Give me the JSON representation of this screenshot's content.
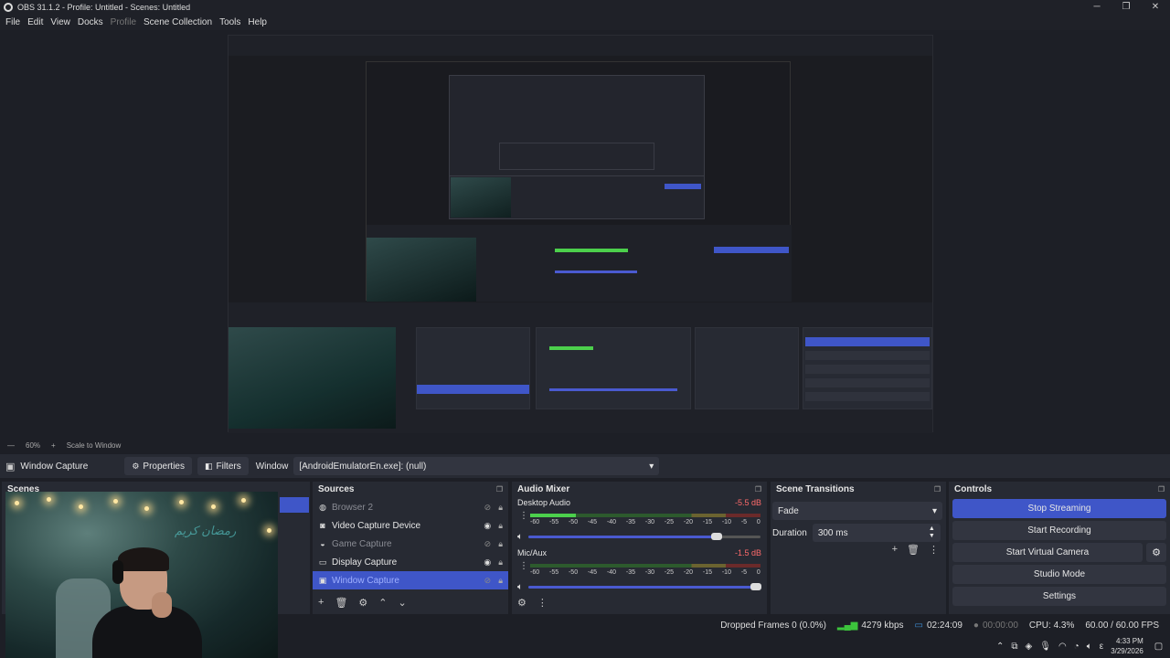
{
  "window": {
    "title": "OBS 31.1.2 - Profile: Untitled - Scenes: Untitled",
    "minimize_glyph": "─",
    "restore_glyph": "❐",
    "close_glyph": "✕"
  },
  "menu": [
    "File",
    "Edit",
    "View",
    "Docks",
    "Profile",
    "Scene Collection",
    "Tools",
    "Help"
  ],
  "zoom": {
    "minus": "—",
    "level": "60%",
    "plus": "+",
    "mode": "Scale to Window"
  },
  "source_toolbar": {
    "source_name": "Window Capture",
    "properties": "Properties",
    "filters": "Filters",
    "window_label": "Window",
    "window_value": "[AndroidEmulatorEn.exe]: (null)"
  },
  "scenes": {
    "title": "Scenes"
  },
  "sources": {
    "title": "Sources",
    "items": [
      {
        "name": "Browser 2",
        "icon": "browser-icon",
        "glyph": "◍",
        "visible": false
      },
      {
        "name": "Video Capture Device",
        "icon": "camera-icon",
        "glyph": "◙",
        "visible": true
      },
      {
        "name": "Game Capture",
        "icon": "gamepad-icon",
        "glyph": "◒",
        "visible": false
      },
      {
        "name": "Display Capture",
        "icon": "monitor-icon",
        "glyph": "▭",
        "visible": true
      },
      {
        "name": "Window Capture",
        "icon": "window-icon",
        "glyph": "▣",
        "visible": false
      }
    ]
  },
  "mixer": {
    "title": "Audio Mixer",
    "scale": [
      "-60",
      "-55",
      "-50",
      "-45",
      "-40",
      "-35",
      "-30",
      "-25",
      "-20",
      "-15",
      "-10",
      "-5",
      "0"
    ],
    "channels": [
      {
        "name": "Desktop Audio",
        "db": "-5.5 dB",
        "level": 0.2,
        "volume": 0.81
      },
      {
        "name": "Mic/Aux",
        "db": "-1.5 dB",
        "level": 0,
        "volume": 0.98
      }
    ]
  },
  "transitions": {
    "title": "Scene Transitions",
    "selected": "Fade",
    "duration_label": "Duration",
    "duration_value": "300 ms"
  },
  "controls": {
    "title": "Controls",
    "stop_streaming": "Stop Streaming",
    "start_recording": "Start Recording",
    "start_virtual_camera": "Start Virtual Camera",
    "studio_mode": "Studio Mode",
    "settings": "Settings"
  },
  "status": {
    "dropped_frames": "Dropped Frames 0 (0.0%)",
    "bitrate": "4279 kbps",
    "stream_time": "02:24:09",
    "record_time": "00:00:00",
    "cpu": "CPU: 4.3%",
    "fps": "60.00 / 60.00 FPS"
  },
  "tray": {
    "time": "4:33 PM",
    "date": "3/29/2026",
    "lang": "ε"
  },
  "webcam": {
    "neon_text": "رمضان كريم"
  },
  "colors": {
    "accent": "#3f56c8",
    "panel": "#272a33",
    "bg": "#1d1f26",
    "meter_green": "#4cd04c"
  }
}
